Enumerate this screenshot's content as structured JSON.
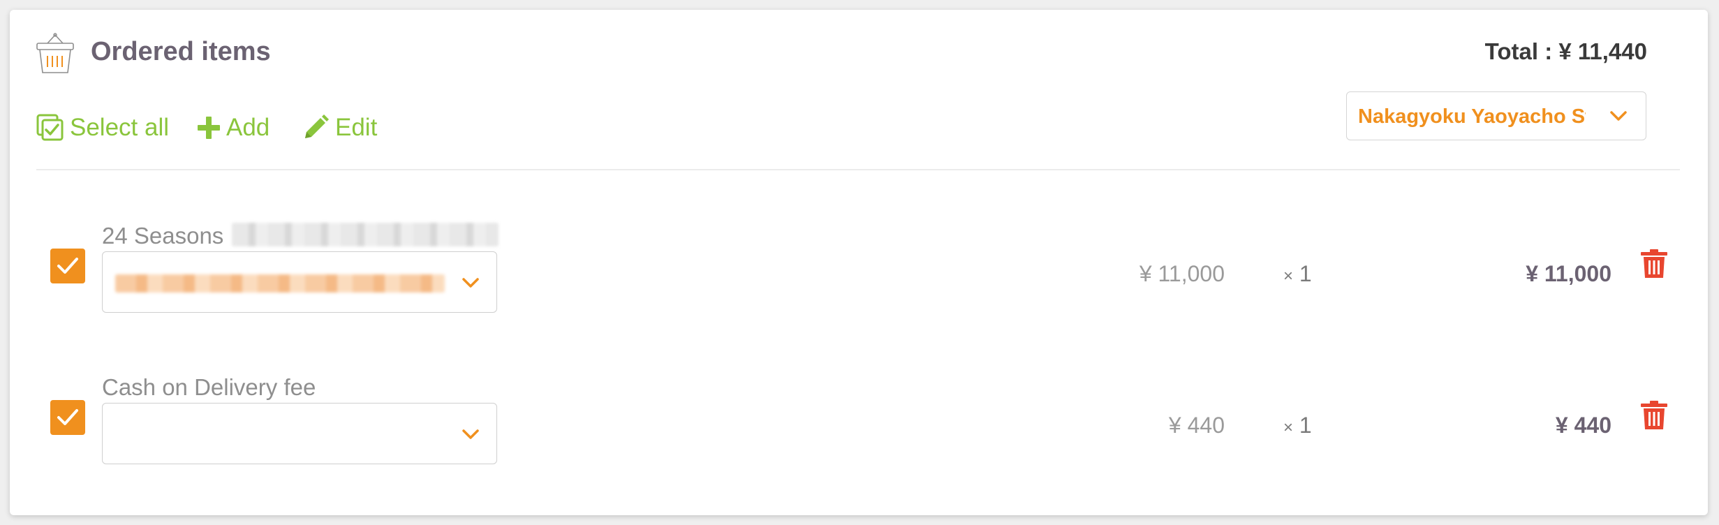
{
  "header": {
    "title": "Ordered items",
    "icon": "basket-icon",
    "total_label": "Total : ¥ 11,440"
  },
  "actions": {
    "select_all": "Select all",
    "add": "Add",
    "edit": "Edit"
  },
  "store_select": {
    "value": "Nakagyoku Yaoyacho Store"
  },
  "items": [
    {
      "name": "24 Seasons",
      "name_has_hidden_suffix": true,
      "checked": true,
      "option_selected": "",
      "option_hidden": true,
      "unit_price": "¥ 11,000",
      "qty_symbol": "×",
      "qty": "1",
      "line_total": "¥ 11,000"
    },
    {
      "name": "Cash on Delivery fee",
      "checked": true,
      "option_selected": "",
      "unit_price": "¥ 440",
      "qty_symbol": "×",
      "qty": "1",
      "line_total": "¥ 440"
    }
  ],
  "colors": {
    "accent_green": "#8ac53c",
    "accent_orange": "#f0901e",
    "delete_red": "#e8462f",
    "title_gray": "#6b6272"
  }
}
